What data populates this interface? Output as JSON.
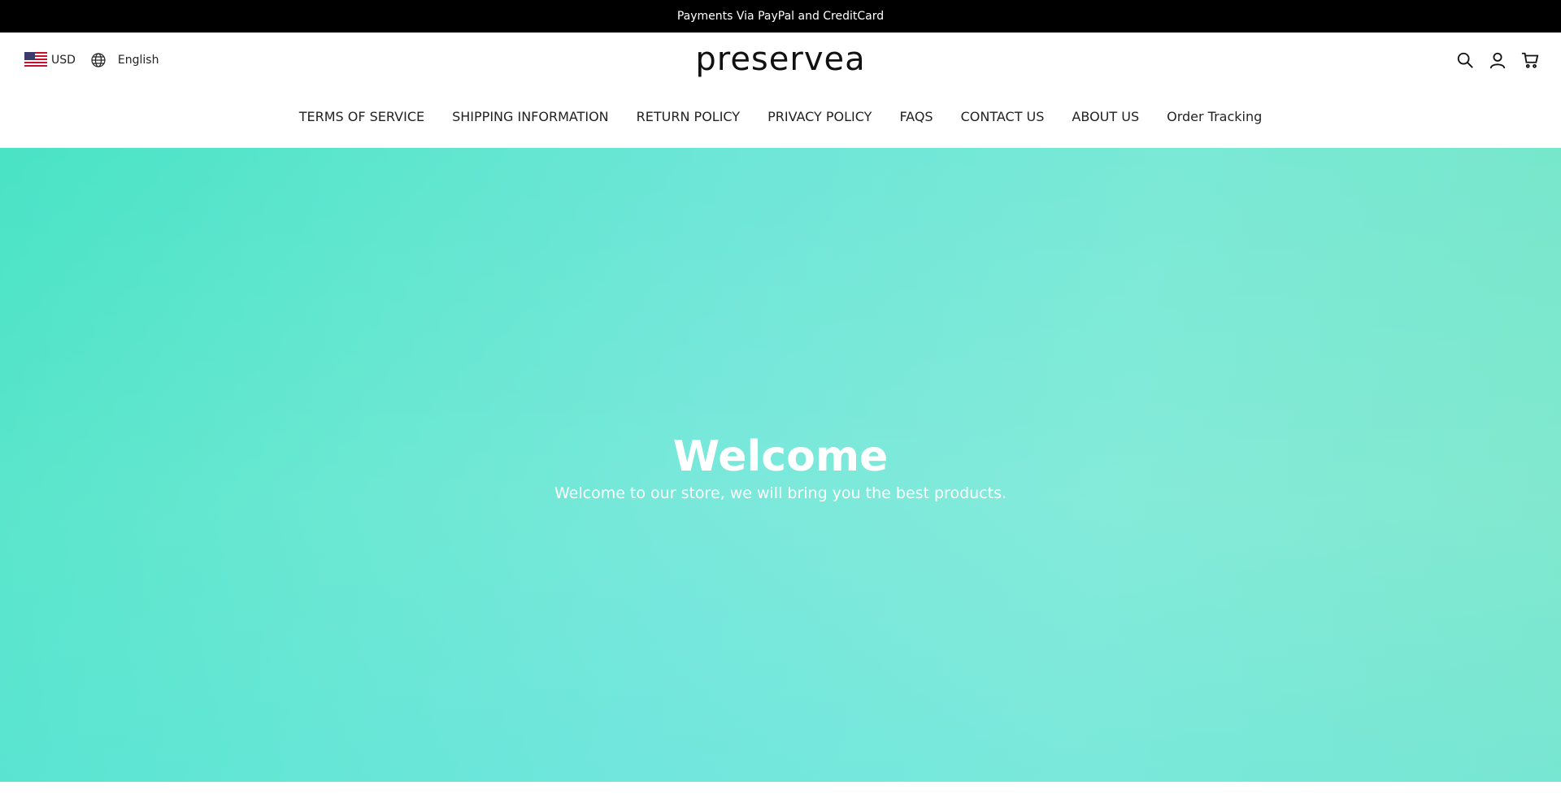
{
  "announcement": {
    "text": "Payments Via PayPal and CreditCard"
  },
  "header": {
    "currency": "USD",
    "language": "English",
    "logo": "preservea",
    "icons": [
      "search-icon",
      "account-icon",
      "cart-icon"
    ]
  },
  "nav": {
    "items": [
      "TERMS OF SERVICE",
      "SHIPPING INFORMATION",
      "RETURN POLICY",
      "PRIVACY POLICY",
      "FAQS",
      "CONTACT US",
      "ABOUT US",
      "Order Tracking"
    ]
  },
  "hero": {
    "title": "Welcome",
    "subtitle": "Welcome to our store, we will bring you the best products."
  },
  "colors": {
    "announcement_bg": "#000000",
    "hero_accent": "#5fe6cf",
    "text": "#222222"
  }
}
